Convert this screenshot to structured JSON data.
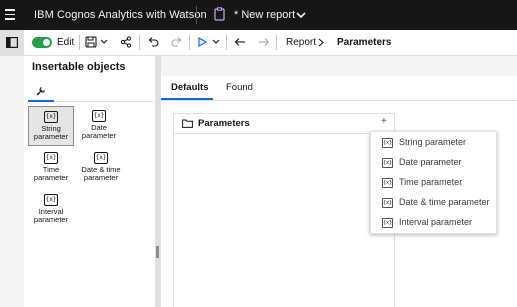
{
  "app": {
    "title": "IBM Cognos Analytics with Watson",
    "report_title": "* New report"
  },
  "toolbar": {
    "edit_label": "Edit",
    "edit_on": true,
    "breadcrumb": [
      "Report",
      "Parameters"
    ]
  },
  "left_panel": {
    "title": "Insertable objects",
    "objects": [
      {
        "icon_text": "{x}",
        "label": "String parameter",
        "selected": true
      },
      {
        "icon_text": "{x}",
        "label": "Date parameter",
        "selected": false
      },
      {
        "icon_text": "{x}",
        "label": "Time parameter",
        "selected": false
      },
      {
        "icon_text": "{x}",
        "label": "Date & time parameter",
        "selected": false
      },
      {
        "icon_text": "{x}",
        "label": "Interval parameter",
        "selected": false
      }
    ]
  },
  "main": {
    "tabs": [
      {
        "label": "Defaults",
        "active": true
      },
      {
        "label": "Found",
        "active": false
      }
    ],
    "panel": {
      "title": "Parameters",
      "add_symbol": "+"
    }
  },
  "menu": {
    "items": [
      {
        "icon_text": "{x}",
        "label": "String parameter"
      },
      {
        "icon_text": "{x}",
        "label": "Date parameter"
      },
      {
        "icon_text": "{x}",
        "label": "Time parameter"
      },
      {
        "icon_text": "{x}",
        "label": "Date & time parameter"
      },
      {
        "icon_text": "{x}",
        "label": "Interval parameter"
      }
    ]
  },
  "colors": {
    "topbar_bg": "#161616",
    "accent": "#0f62fe",
    "toggle_on": "#24a148"
  }
}
